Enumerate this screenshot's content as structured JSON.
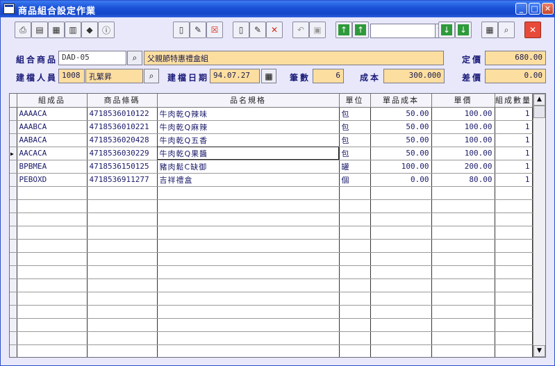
{
  "window": {
    "title": "商品組合設定作業",
    "minimize": "_",
    "maximize": "□",
    "close": "✕"
  },
  "toolbar": {
    "icons": [
      "print-icon",
      "preview-icon",
      "calculator-icon",
      "calendar-icon",
      "book-icon",
      "info-icon",
      "new-icon",
      "edit-icon",
      "delete-icon",
      "copy-icon",
      "save-icon",
      "cancel-icon",
      "disk-icon",
      "first-record-icon",
      "prev-record-icon",
      "next-record-icon",
      "last-record-icon",
      "table-icon",
      "find-icon",
      "exit-icon"
    ],
    "nav_combo_value": ""
  },
  "form": {
    "combo_product_label": "組合商品",
    "combo_product_code": "DAD-05",
    "combo_product_name": "父親節特惠禮盒組",
    "list_price_label": "定價",
    "list_price": "680.00",
    "creator_label": "建檔人員",
    "creator_id": "1008",
    "creator_name": "孔繁昇",
    "create_date_label": "建檔日期",
    "create_date": "94.07.27",
    "count_label": "筆數",
    "count": "6",
    "cost_label": "成本",
    "cost": "300.000",
    "diff_label": "差價",
    "diff": "0.00"
  },
  "grid": {
    "columns": [
      "組成品",
      "商品條碼",
      "品名規格",
      "單位",
      "單品成本",
      "單價",
      "組成數量"
    ],
    "rows": [
      {
        "code": "AAAACA",
        "barcode": "4718536010122",
        "name": "牛肉乾Q辣味",
        "unit": "包",
        "cost": "50.00",
        "price": "100.00",
        "qty": "1"
      },
      {
        "code": "AAABCA",
        "barcode": "4718536010221",
        "name": "牛肉乾Q麻辣",
        "unit": "包",
        "cost": "50.00",
        "price": "100.00",
        "qty": "1"
      },
      {
        "code": "AABACA",
        "barcode": "4718536020428",
        "name": "牛肉乾Q五香",
        "unit": "包",
        "cost": "50.00",
        "price": "100.00",
        "qty": "1"
      },
      {
        "code": "AACACA",
        "barcode": "4718536030229",
        "name": "牛肉乾Q果醬",
        "unit": "包",
        "cost": "50.00",
        "price": "100.00",
        "qty": "1"
      },
      {
        "code": "BPBMEA",
        "barcode": "4718536150125",
        "name": "豬肉鬆C缺御",
        "unit": "罐",
        "cost": "100.00",
        "price": "200.00",
        "qty": "1"
      },
      {
        "code": "PEBOXD",
        "barcode": "4718536911277",
        "name": "吉祥禮盒",
        "unit": "個",
        "cost": "0.00",
        "price": "80.00",
        "qty": "1"
      }
    ],
    "current_row": 3
  }
}
